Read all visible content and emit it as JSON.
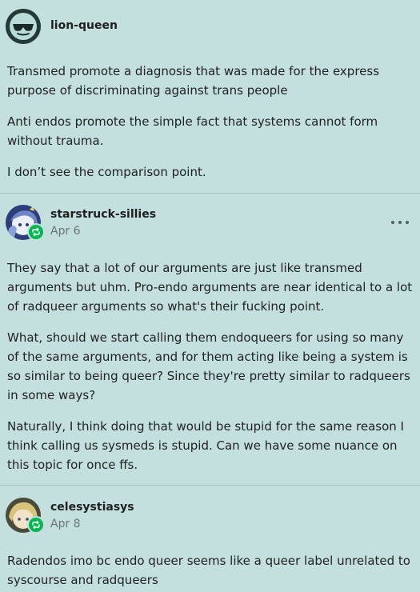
{
  "posts": [
    {
      "username": "lion-queen",
      "avatar_icon": "sunglasses-face-icon",
      "paragraphs": [
        "Transmed promote a diagnosis that was made for the express purpose of discriminating against trans people",
        "Anti endos promote the simple fact that systems cannot form without trauma.",
        "I don’t see the comparison point."
      ]
    },
    {
      "username": "starstruck-sillies",
      "date": "Apr 6",
      "avatar_icon": "anime-avatar-icon",
      "badge_icon": "reblog-icon",
      "paragraphs": [
        "They say that a lot of our arguments are just like transmed arguments but uhm. Pro-endo arguments are near identical to a lot of radqueer arguments so what's their fucking point.",
        "What, should we start calling them endoqueers for using so many of the same arguments, and for them acting like being a system is so similar to being queer? Since they're pretty similar to radqueers in some ways?",
        "Naturally, I think doing that would be stupid for the same reason I think calling us sysmeds is stupid. Can we have some nuance on this topic for once ffs."
      ]
    },
    {
      "username": "celesystiasys",
      "date": "Apr 8",
      "avatar_icon": "anime-avatar-icon",
      "badge_icon": "reblog-icon",
      "paragraphs": [
        "Radendos imo bc endo queer seems like a queer label unrelated to syscourse and radqueers"
      ]
    }
  ],
  "colors": {
    "background": "#c3e0de",
    "divider": "#a6c7c4",
    "reblog_badge": "#00b84f",
    "date_text": "#6a7574",
    "body_text": "#222222"
  }
}
